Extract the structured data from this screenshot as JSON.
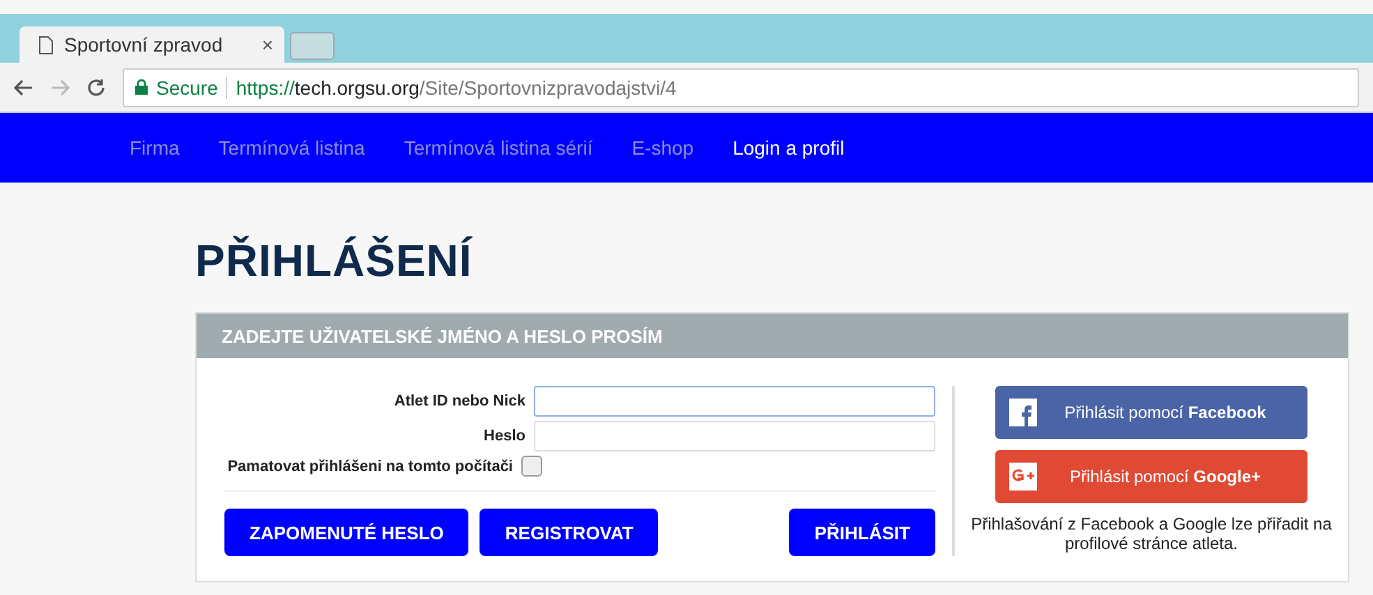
{
  "browser": {
    "tab_title": "Sportovní zpravod",
    "tab_close": "×",
    "secure_label": "Secure",
    "url_scheme": "https://",
    "url_host": "tech.orgsu.org",
    "url_path": "/Site/Sportovnizpravodajstvi/4"
  },
  "nav": [
    {
      "label": "Firma",
      "selected": false
    },
    {
      "label": "Termínová listina",
      "selected": false
    },
    {
      "label": "Termínová listina sérií",
      "selected": false
    },
    {
      "label": "E-shop",
      "selected": false
    },
    {
      "label": "Login a profil",
      "selected": true
    }
  ],
  "page_title": "PŘIHLÁŠENÍ",
  "panel": {
    "header": "ZADEJTE UŽIVATELSKÉ JMÉNO A HESLO PROSÍM",
    "fields": [
      {
        "label": "Atlet ID nebo Nick",
        "focused": true
      },
      {
        "label": "Heslo",
        "focused": false
      }
    ],
    "remember": {
      "label": "Pamatovat přihlášeni na tomto počítači",
      "checked": false
    },
    "buttons": [
      {
        "label": "ZAPOMENUTÉ HESLO",
        "kind": "left"
      },
      {
        "label": "REGISTROVAT",
        "kind": "left"
      },
      {
        "label": "PŘIHLÁSIT",
        "kind": "right"
      }
    ],
    "social": [
      {
        "kind": "facebook",
        "label": "Přihlásit pomocí **Facebook**"
      },
      {
        "kind": "google",
        "label": "Přihlásit pomocí **Google+**"
      }
    ],
    "note": "Přihlašování z Facebook a Google lze přiřadit na profilové stránce atleta."
  }
}
